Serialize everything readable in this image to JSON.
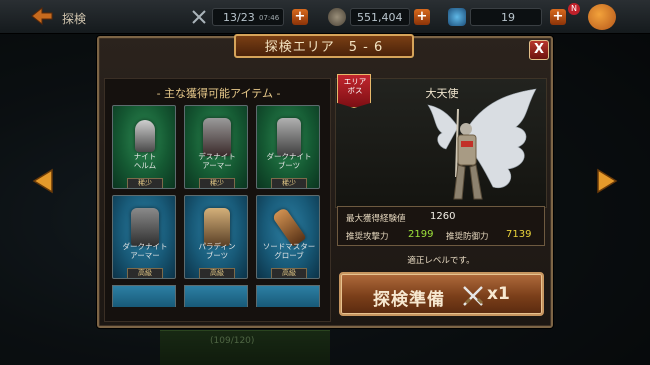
{
  "topbar": {
    "title": "探検",
    "stamina": "13/23",
    "stamina_timer": "07:46",
    "gold": "551,404",
    "gems": "19",
    "notification_badge": "N"
  },
  "dialog": {
    "title": "探検エリア　5 - 6",
    "close_label": "X",
    "items_section_title": "- 主な獲得可能アイテム -",
    "items": [
      {
        "name": "ナイト\nヘルム",
        "rarity": "稀少",
        "frame": "green"
      },
      {
        "name": "デスナイト\nアーマー",
        "rarity": "稀少",
        "frame": "green"
      },
      {
        "name": "ダークナイト\nブーツ",
        "rarity": "稀少",
        "frame": "green"
      },
      {
        "name": "ダークナイト\nアーマー",
        "rarity": "高級",
        "frame": "blue"
      },
      {
        "name": "パラディン\nブーツ",
        "rarity": "高級",
        "frame": "blue"
      },
      {
        "name": "ソードマスター\nグローブ",
        "rarity": "高級",
        "frame": "blue"
      }
    ],
    "boss": {
      "ribbon": "エリア\nボス",
      "name": "大天使",
      "max_exp_label": "最大獲得経験値",
      "max_exp_value": "1260",
      "atk_label": "推奨攻撃力",
      "atk_value": "2199",
      "def_label": "推奨防御力",
      "def_value": "7139",
      "level_note": "適正レベルです。"
    },
    "ready_button": {
      "label": "探検準備",
      "count": "x1"
    }
  },
  "background": {
    "progress_text": "(109/120)"
  },
  "colors": {
    "rare_frame": "#1e6a3f",
    "high_frame": "#1d6488",
    "accent_orange": "#d86a1e",
    "atk_green": "#9ce13a",
    "def_yellow": "#e8d23a"
  }
}
